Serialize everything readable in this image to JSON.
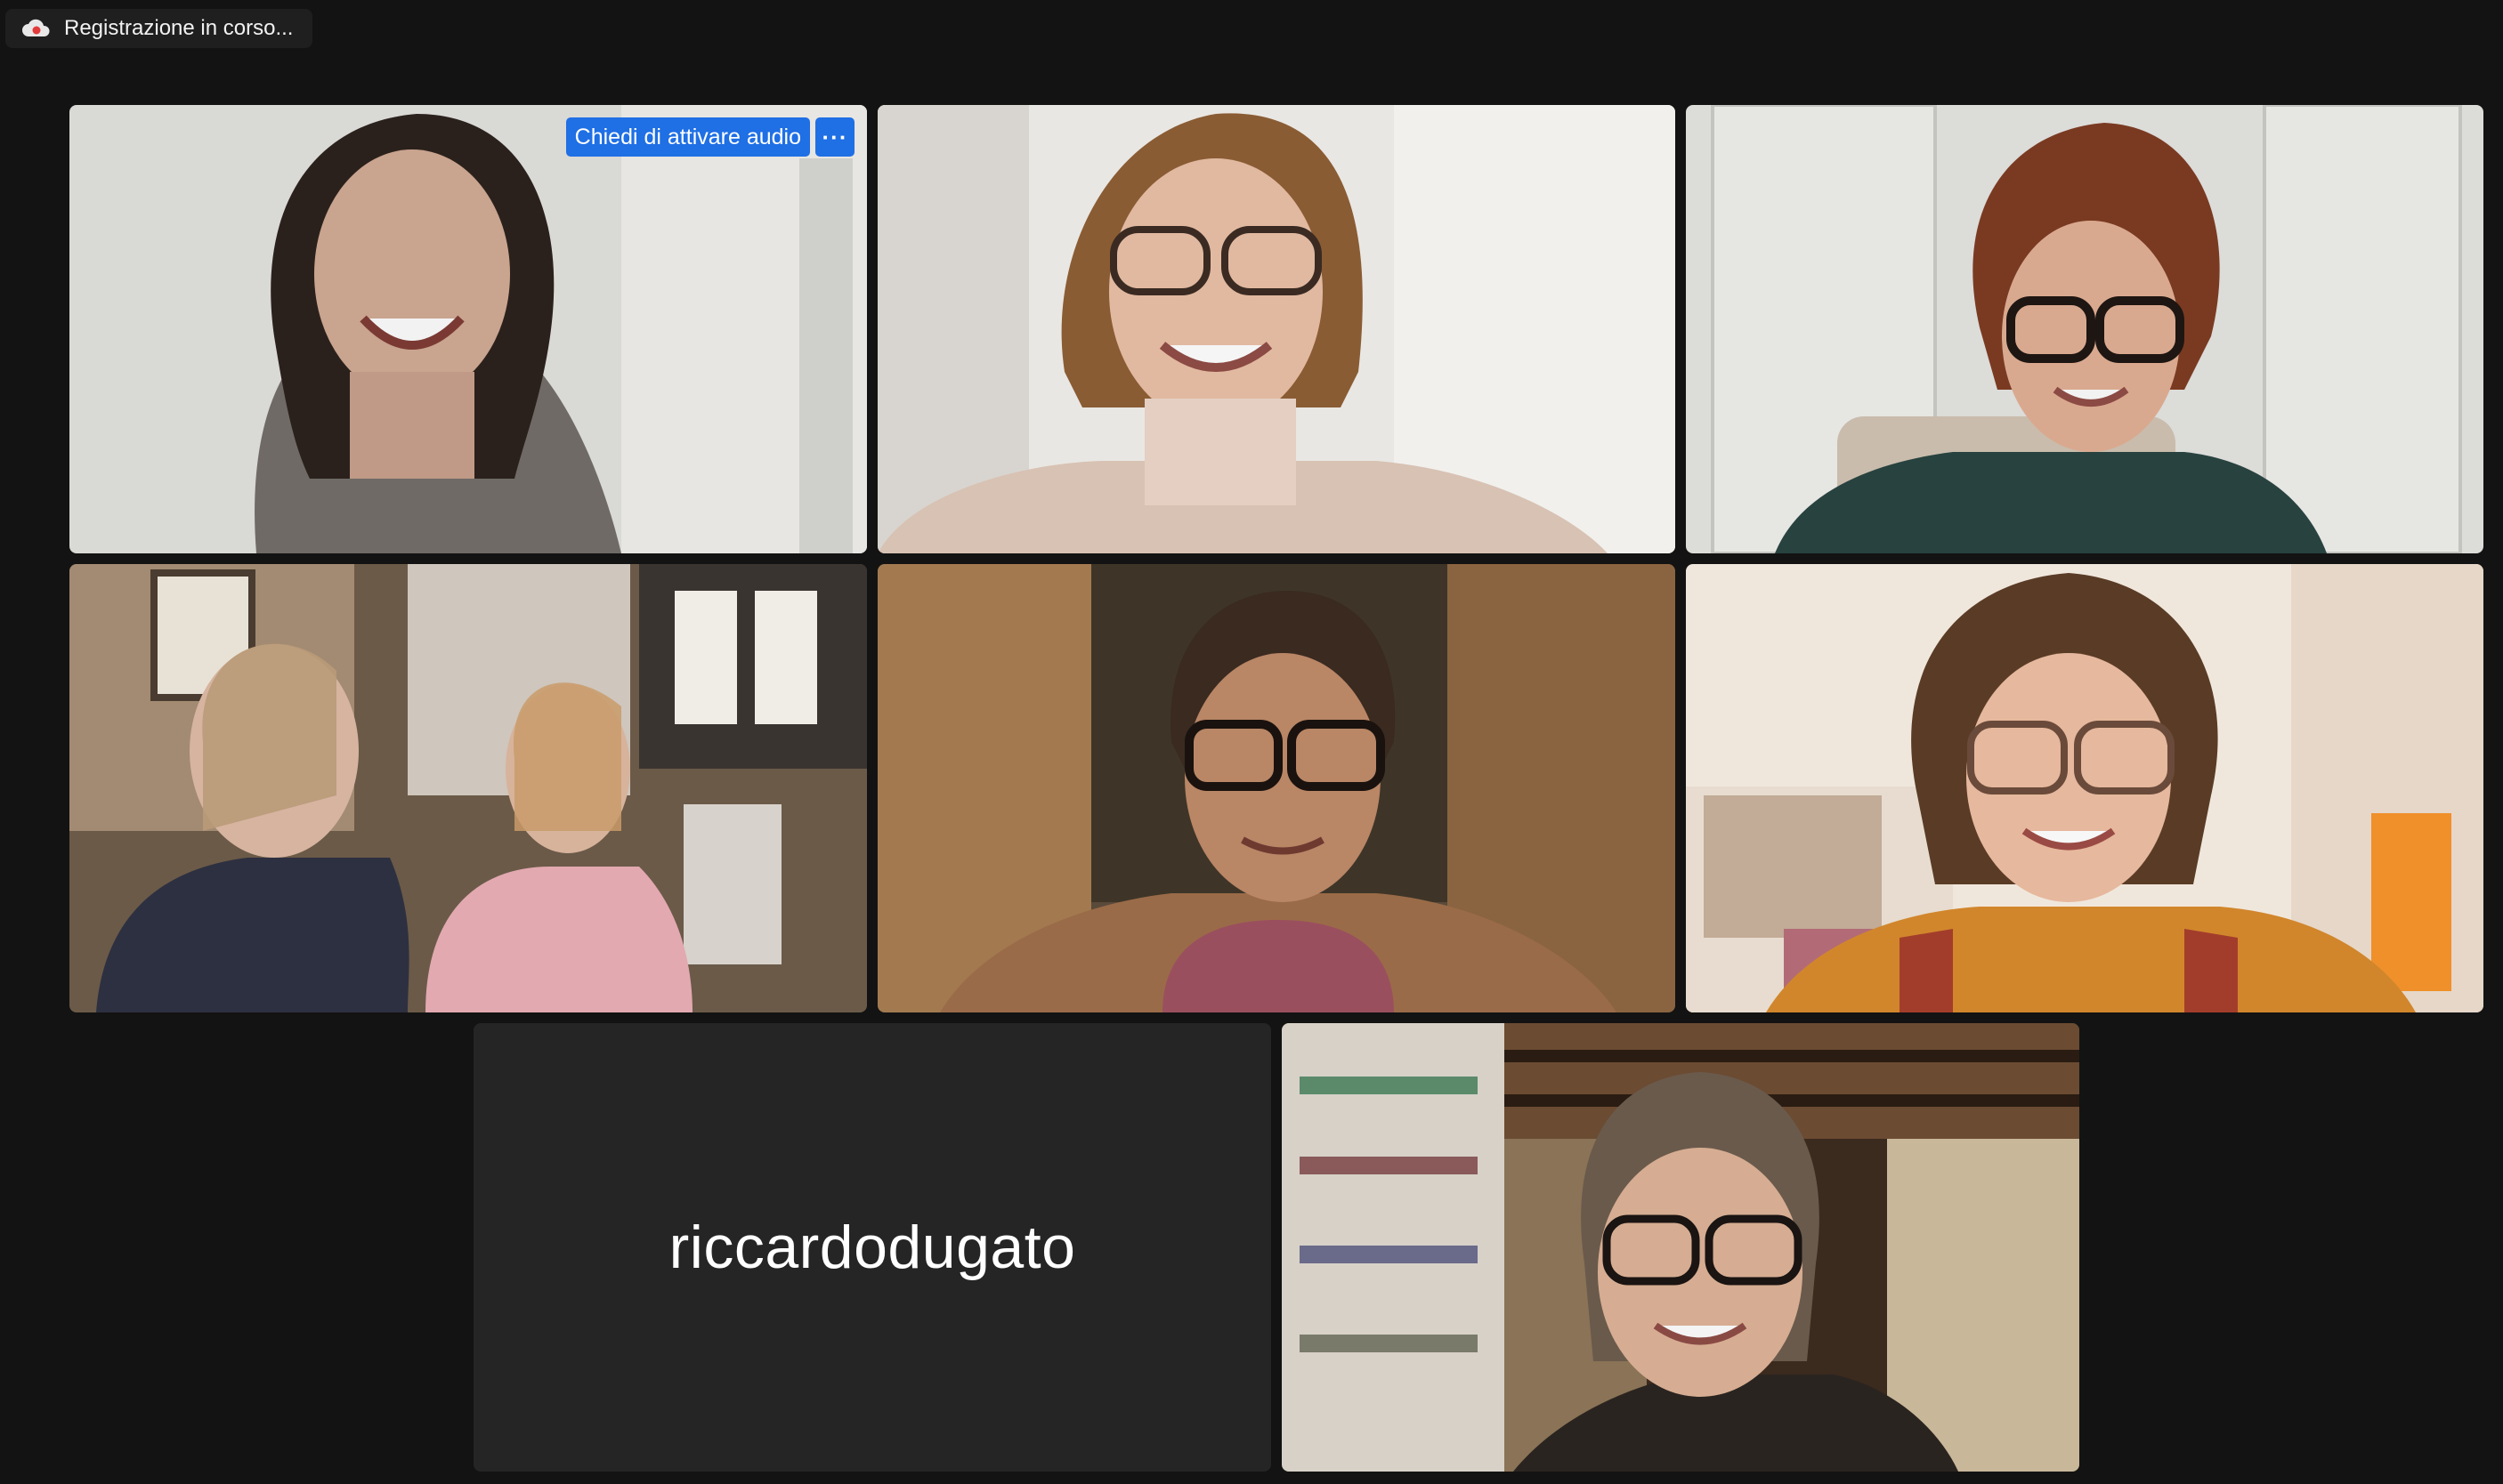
{
  "recording": {
    "label": "Registrazione in corso...",
    "icon": "cloud-recording-icon"
  },
  "gallery": {
    "tiles": [
      {
        "id": "participant-1",
        "type": "video",
        "overlay": {
          "audio_request_label": "Chiedi di attivare audio",
          "more_label": "···"
        }
      },
      {
        "id": "participant-2",
        "type": "video"
      },
      {
        "id": "participant-3",
        "type": "video"
      },
      {
        "id": "participant-4",
        "type": "video"
      },
      {
        "id": "participant-5",
        "type": "video"
      },
      {
        "id": "participant-6",
        "type": "video"
      },
      {
        "id": "participant-7",
        "type": "name",
        "name": "riccardodugato"
      },
      {
        "id": "participant-8",
        "type": "video",
        "active_speaker": true
      }
    ]
  },
  "colors": {
    "background": "#131313",
    "active_speaker_border": "#6ed14c",
    "audio_button": "#1f6fe5",
    "name_tile_bg": "#252525"
  }
}
